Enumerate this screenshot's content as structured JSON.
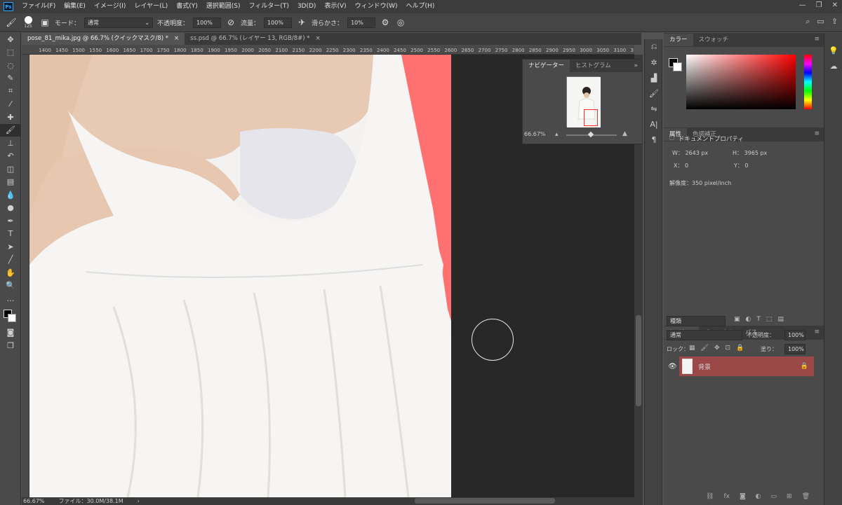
{
  "app": {
    "logo_text": "Ps"
  },
  "menu": [
    "ファイル(F)",
    "編集(E)",
    "イメージ(I)",
    "レイヤー(L)",
    "書式(Y)",
    "選択範囲(S)",
    "フィルター(T)",
    "3D(D)",
    "表示(V)",
    "ウィンドウ(W)",
    "ヘルプ(H)"
  ],
  "options": {
    "brush_size": "125",
    "mode_label": "モード：",
    "mode_value": "通常",
    "opacity_label": "不透明度：",
    "opacity_value": "100%",
    "flow_label": "流量：",
    "flow_value": "100%",
    "smoothing_label": "滑らかさ：",
    "smoothing_value": "10%"
  },
  "tabs": [
    {
      "label": "pose_81_mika.jpg @ 66.7% (クイックマスク/8) *",
      "close": "×"
    },
    {
      "label": "ss.psd @ 66.7% (レイヤー 13, RGB/8#) *",
      "close": "×"
    }
  ],
  "ruler_ticks": [
    "1400",
    "1450",
    "1500",
    "1550",
    "1600",
    "1650",
    "1700",
    "1750",
    "1800",
    "1850",
    "1900",
    "1950",
    "2000",
    "2050",
    "2100",
    "2150",
    "2200",
    "2250",
    "2300",
    "2350",
    "2400",
    "2450",
    "2500",
    "2550",
    "2600",
    "2650",
    "2700",
    "2750",
    "2800",
    "2850",
    "2900",
    "2950",
    "3000",
    "3050",
    "3100",
    "3150"
  ],
  "status": {
    "zoom": "66.67%",
    "file": "ファイル：30.0M/38.1M"
  },
  "navigator": {
    "tab1": "ナビゲーター",
    "tab2": "ヒストグラム",
    "zoom": "66.67%"
  },
  "color_panel": {
    "tab1": "カラー",
    "tab2": "スウォッチ",
    "fg_color": "#000000",
    "bg_color": "#ffffff"
  },
  "properties": {
    "tab1": "属性",
    "tab2": "色調補正",
    "title": "ドキュメントプロパティ",
    "w": "W： 2643 px",
    "h": "H： 3965 px",
    "x": "X： 0",
    "y": "Y： 0",
    "resolution": "解像度：350 pixel/inch"
  },
  "layers": {
    "tab1": "レイヤー",
    "tab2": "チャンネル",
    "tab3": "パス",
    "filter_label": "種類",
    "blend_mode": "通常",
    "opacity_label": "不透明度：",
    "opacity_value": "100%",
    "lock_label": "ロック：",
    "fill_label": "塗り：",
    "fill_value": "100%",
    "layer_name": "背景"
  },
  "colors": {
    "mask_red": "#ff7171",
    "layer_selected": "#9a4848"
  }
}
